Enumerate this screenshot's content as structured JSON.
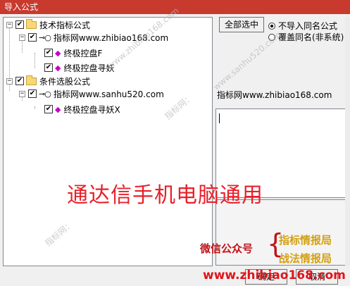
{
  "window": {
    "title": "导入公式"
  },
  "tree": {
    "groups": [
      {
        "label": "技术指标公式",
        "checked": true,
        "source": {
          "label": "指标网www.zhibiao168.com",
          "checked": true,
          "items": [
            {
              "label": "终极控盘F",
              "checked": true
            },
            {
              "label": "终极控盘寻妖",
              "checked": true
            }
          ]
        }
      },
      {
        "label": "条件选股公式",
        "checked": true,
        "source": {
          "label": "指标网www.sanhu520.com",
          "checked": true,
          "items": [
            {
              "label": "终极控盘寻妖X",
              "checked": true
            }
          ]
        }
      }
    ]
  },
  "controls": {
    "select_all_label": "全部选中",
    "radio_no_import": "不导入同名公式",
    "radio_overwrite": "覆盖同名(非系统)",
    "selected_radio": "no_import"
  },
  "info": {
    "source_name": "指标网www.zhibiao168.com"
  },
  "buttons": {
    "ok_label": "确定",
    "cancel_label": "取消"
  },
  "overlay": {
    "banner": "通达信手机电脑通用",
    "wechat_label": "微信公众号",
    "account_1": "指标情报局",
    "account_2": "战法情报局",
    "site": "www.zhibiao168.com",
    "watermarks": [
      "www.sanhu520.com",
      "www.zhibiao168.com",
      "指标网：",
      "指标网："
    ]
  },
  "icons": {
    "folder": "folder-icon",
    "key": "key-icon",
    "formula": "formula-icon"
  },
  "colors": {
    "title_bar": "#c83a2e",
    "banner": "#e8202a",
    "accent_gold": "#d4a010"
  }
}
